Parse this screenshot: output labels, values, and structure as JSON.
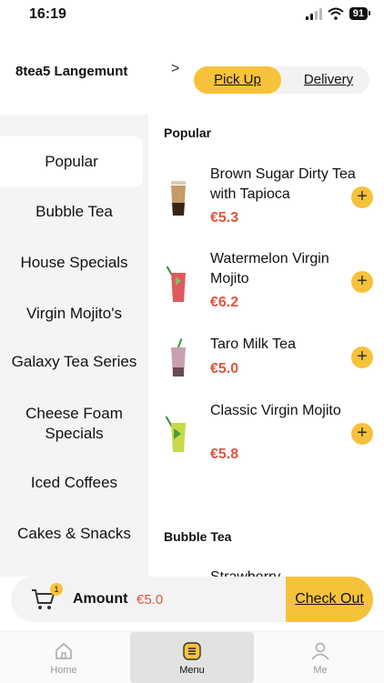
{
  "status": {
    "time": "16:19",
    "battery": "91"
  },
  "header": {
    "store_name": "8tea5 Langemunt",
    "pickup_label": "Pick Up",
    "delivery_label": "Delivery"
  },
  "sidebar": {
    "categories": [
      "Popular",
      "Bubble Tea",
      "House Specials",
      "Virgin Mojito's",
      "Galaxy Tea Series",
      "Cheese Foam Specials",
      "Iced Coffees",
      "Cakes & Snacks"
    ]
  },
  "content": {
    "sections": [
      {
        "title": "Popular"
      },
      {
        "title": "Bubble Tea"
      }
    ],
    "items": [
      {
        "name": "Brown Sugar Dirty Tea with Tapioca",
        "price": "€5.3"
      },
      {
        "name": "Watermelon Virgin Mojito",
        "price": "€6.2"
      },
      {
        "name": "Taro Milk Tea",
        "price": "€5.0"
      },
      {
        "name": "Classic Virgin Mojito",
        "price": "€5.8"
      },
      {
        "name": "Strawberry",
        "price": ""
      }
    ]
  },
  "cart": {
    "badge": "1",
    "amount_label": "Amount",
    "amount_value": "€5.0",
    "checkout_label": "Check Out"
  },
  "tabbar": {
    "tabs": [
      {
        "label": "Home"
      },
      {
        "label": "Menu"
      },
      {
        "label": "Me"
      }
    ]
  },
  "colors": {
    "accent": "#f7c23b",
    "price": "#e0553f"
  }
}
